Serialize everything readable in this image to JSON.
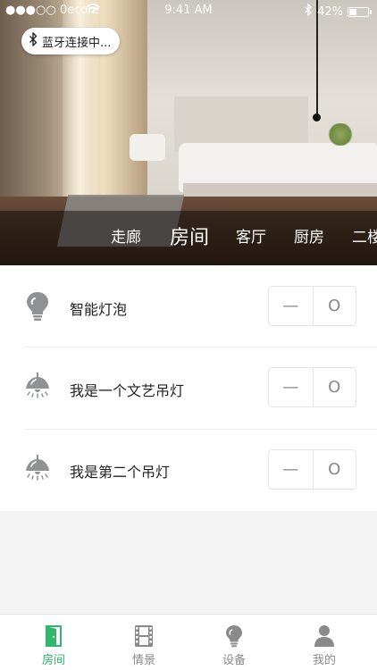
{
  "status_bar": {
    "carrier": "●●●○○ 0ecore",
    "time": "9:41 AM",
    "battery": "42%",
    "battery_level": 0.42
  },
  "bluetooth": {
    "label": "蓝牙连接中..."
  },
  "room_tabs": [
    {
      "label": "走廊",
      "active": false
    },
    {
      "label": "房间",
      "active": true
    },
    {
      "label": "客厅",
      "active": false
    },
    {
      "label": "厨房",
      "active": false
    },
    {
      "label": "二楼",
      "active": false
    }
  ],
  "devices": [
    {
      "name": "智能灯泡",
      "icon": "lightbulb-icon",
      "minus": "—",
      "value": "O"
    },
    {
      "name": "我是一个文艺吊灯",
      "icon": "pendant-lamp-icon",
      "minus": "—",
      "value": "O"
    },
    {
      "name": "我是第二个吊灯",
      "icon": "pendant-lamp-icon",
      "minus": "—",
      "value": "O"
    }
  ],
  "tab_bar": [
    {
      "label": "房间",
      "icon": "door-icon",
      "active": true
    },
    {
      "label": "情景",
      "icon": "film-icon",
      "active": false
    },
    {
      "label": "设备",
      "icon": "lightbulb-icon",
      "active": false
    },
    {
      "label": "我的",
      "icon": "person-icon",
      "active": false
    }
  ],
  "colors": {
    "accent": "#2fb86a",
    "tab_inactive": "#8a8a8a",
    "icon_gray": "#8f9193"
  }
}
